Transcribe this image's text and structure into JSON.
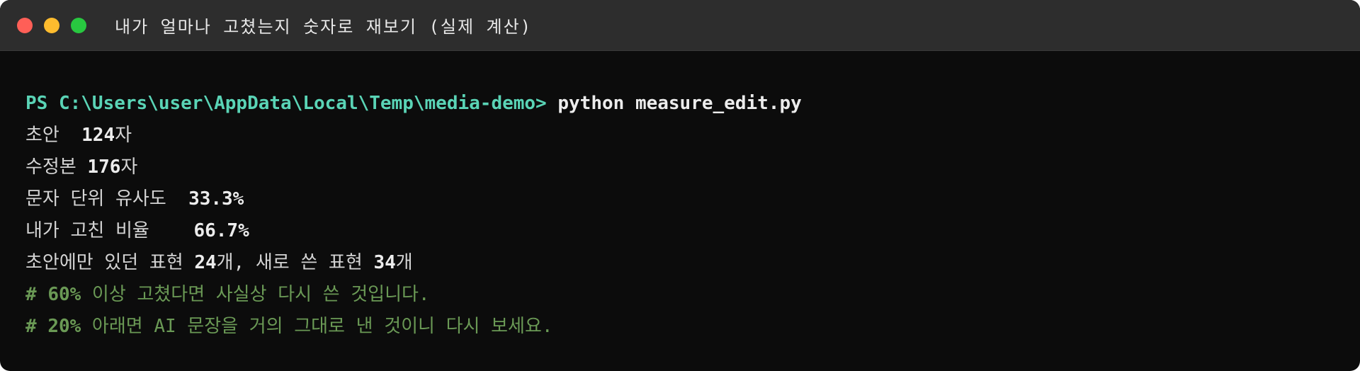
{
  "window": {
    "title": "내가 얼마나 고쳤는지 숫자로 재보기 (실제 계산)"
  },
  "terminal": {
    "prompt": "PS C:\\Users\\user\\AppData\\Local\\Temp\\media-demo>",
    "command": "python measure_edit.py",
    "lines": [
      {
        "label": "초안  ",
        "value": "124",
        "unit": "자"
      },
      {
        "label": "수정본 ",
        "value": "176",
        "unit": "자"
      },
      {
        "label": "문자 단위 유사도  ",
        "value": "33.3%",
        "unit": ""
      },
      {
        "label": "내가 고친 비율    ",
        "value": "66.7%",
        "unit": ""
      }
    ],
    "summary": {
      "part1": "초안에만 있던 표현 ",
      "count1": "24",
      "part2": "개, 새로 쓴 표현 ",
      "count2": "34",
      "part3": "개"
    },
    "comments": [
      {
        "hash": "# ",
        "strong": "60%",
        "text": " 이상 고쳤다면 사실상 다시 쓴 것입니다."
      },
      {
        "hash": "# ",
        "strong": "20%",
        "text": " 아래면 AI 문장을 거의 그대로 낸 것이니 다시 보세요."
      }
    ]
  },
  "colors": {
    "background": "#0c0c0c",
    "titlebar": "#2d2d2d",
    "prompt": "#5ad4b6",
    "comment": "#6a9955",
    "close": "#ff5f57",
    "minimize": "#febc2e",
    "maximize": "#28c840"
  }
}
